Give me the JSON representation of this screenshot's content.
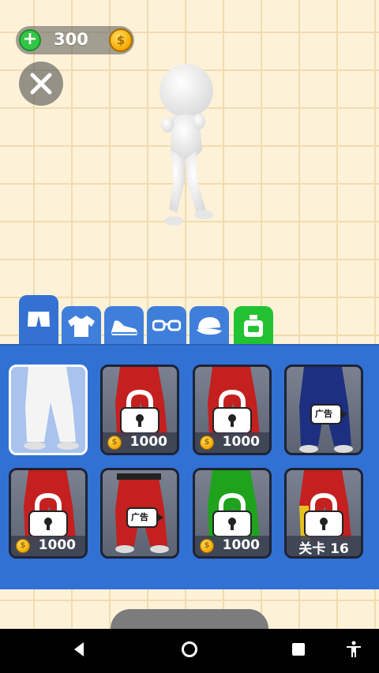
{
  "currency": {
    "amount": "300",
    "add_icon": "plus-icon",
    "coin_symbol": "$"
  },
  "close_icon": "close-icon",
  "tabs": [
    {
      "name": "shorts-tab",
      "icon": "shorts-icon",
      "active": true
    },
    {
      "name": "shirt-tab",
      "icon": "tshirt-icon",
      "active": false
    },
    {
      "name": "shoe-tab",
      "icon": "sneaker-icon",
      "active": false
    },
    {
      "name": "glasses-tab",
      "icon": "glasses-icon",
      "active": false
    },
    {
      "name": "cap-tab",
      "icon": "cap-icon",
      "active": false
    },
    {
      "name": "bottle-tab",
      "icon": "bottle-icon",
      "active": false
    }
  ],
  "items": [
    {
      "color": "#ffffff",
      "status": "selected"
    },
    {
      "color": "#c4201f",
      "status": "locked",
      "price": "1000"
    },
    {
      "color": "#c4201f",
      "status": "locked",
      "price": "1000"
    },
    {
      "color": "#1d2f80",
      "status": "ad",
      "ad_label": "广告"
    },
    {
      "color": "#c4201f",
      "status": "locked",
      "price": "1000"
    },
    {
      "color": "#c4201f",
      "status": "ad",
      "ad_label": "广告"
    },
    {
      "color": "#1fa31d",
      "status": "locked",
      "price": "1000"
    },
    {
      "color": "#c4201f",
      "status": "level",
      "level_label": "关卡 16"
    }
  ],
  "colors": {
    "panel": "#3271d4",
    "tab": "#3f7fdb",
    "special_tab": "#22c233",
    "coin": "#f3a900"
  }
}
